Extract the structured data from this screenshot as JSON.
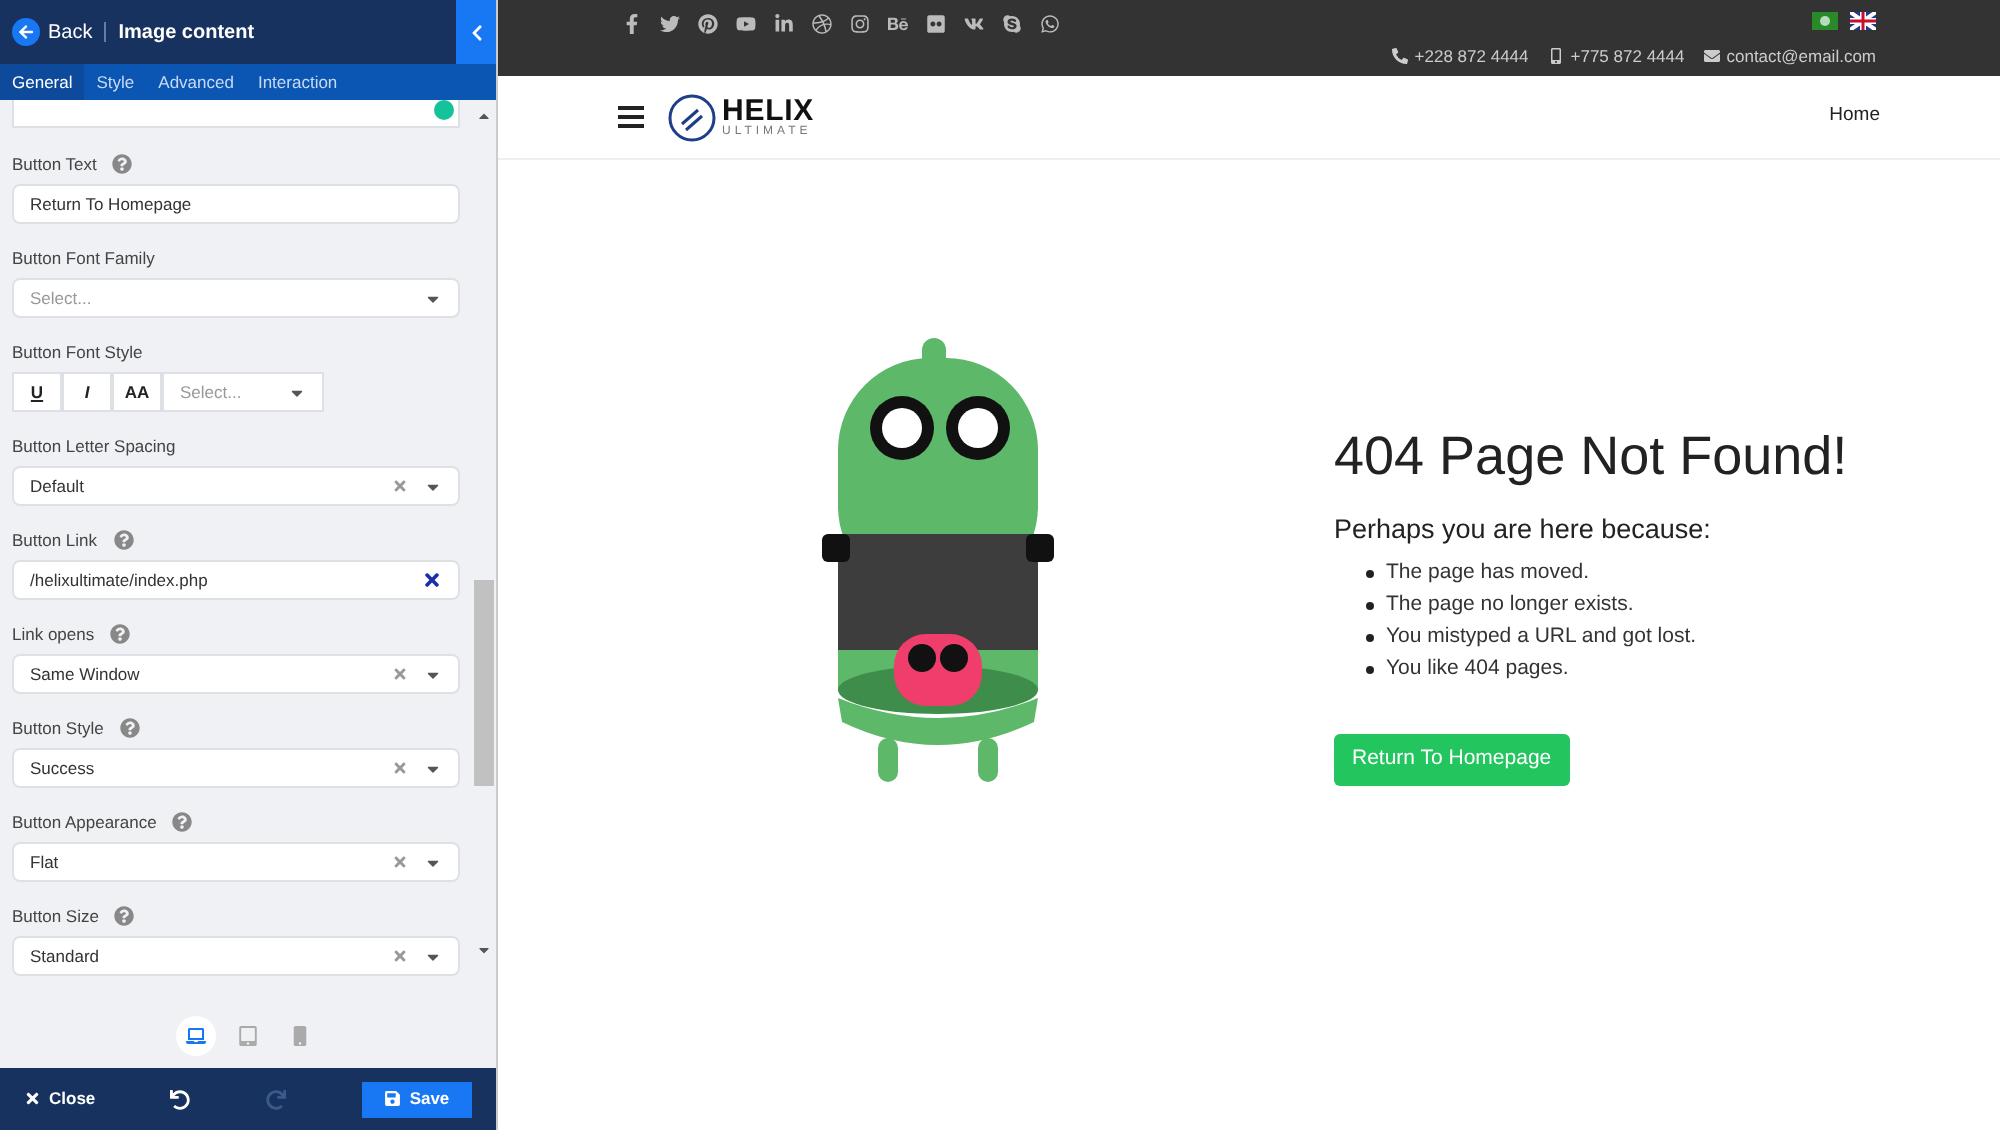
{
  "panel": {
    "back": "Back",
    "title": "Image content",
    "tabs": [
      {
        "label": "General",
        "selected": true
      },
      {
        "label": "Style",
        "selected": false
      },
      {
        "label": "Advanced",
        "selected": false
      },
      {
        "label": "Interaction",
        "selected": false
      }
    ],
    "fields": [
      {
        "kind": "text",
        "label": "Button Text",
        "help": true,
        "value": "Return To Homepage"
      },
      {
        "kind": "select",
        "label": "Button Font Family",
        "help": false,
        "placeholder": "Select..."
      },
      {
        "kind": "style",
        "label": "Button Font Style",
        "help": false,
        "buttons": [
          "U",
          "I",
          "AA"
        ],
        "placeholder": "Select..."
      },
      {
        "kind": "select",
        "label": "Button Letter Spacing",
        "help": false,
        "value": "Default",
        "clearable": true
      },
      {
        "kind": "link",
        "label": "Button Link",
        "help": true,
        "value": "/helixultimate/index.php"
      },
      {
        "kind": "select",
        "label": "Link opens",
        "help": true,
        "value": "Same Window",
        "clearable": true
      },
      {
        "kind": "select",
        "label": "Button Style",
        "help": true,
        "value": "Success",
        "clearable": true
      },
      {
        "kind": "select",
        "label": "Button Appearance",
        "help": true,
        "value": "Flat",
        "clearable": true
      },
      {
        "kind": "select",
        "label": "Button Size",
        "help": true,
        "value": "Standard",
        "clearable": true
      }
    ],
    "devices": [
      {
        "kind": "desktop",
        "selected": true
      },
      {
        "kind": "tablet",
        "selected": false
      },
      {
        "kind": "mobile",
        "selected": false
      }
    ],
    "close": "Close",
    "save": "Save"
  },
  "site": {
    "contacts": [
      {
        "kind": "phone",
        "text": "+228 872 4444"
      },
      {
        "kind": "mobile",
        "text": "+775 872 4444"
      },
      {
        "kind": "email",
        "text": "contact@email.com"
      }
    ],
    "logo": {
      "name": "HELIX",
      "tagline": "ULTIMATE"
    },
    "menu": [
      "Home"
    ],
    "heading": "404 Page Not Found!",
    "subheading": "Perhaps you are here because:",
    "reasons": [
      "The page has moved.",
      "The page no longer exists.",
      "You mistyped a URL and got lost.",
      "You like 404 pages."
    ],
    "button": "Return To Homepage"
  }
}
